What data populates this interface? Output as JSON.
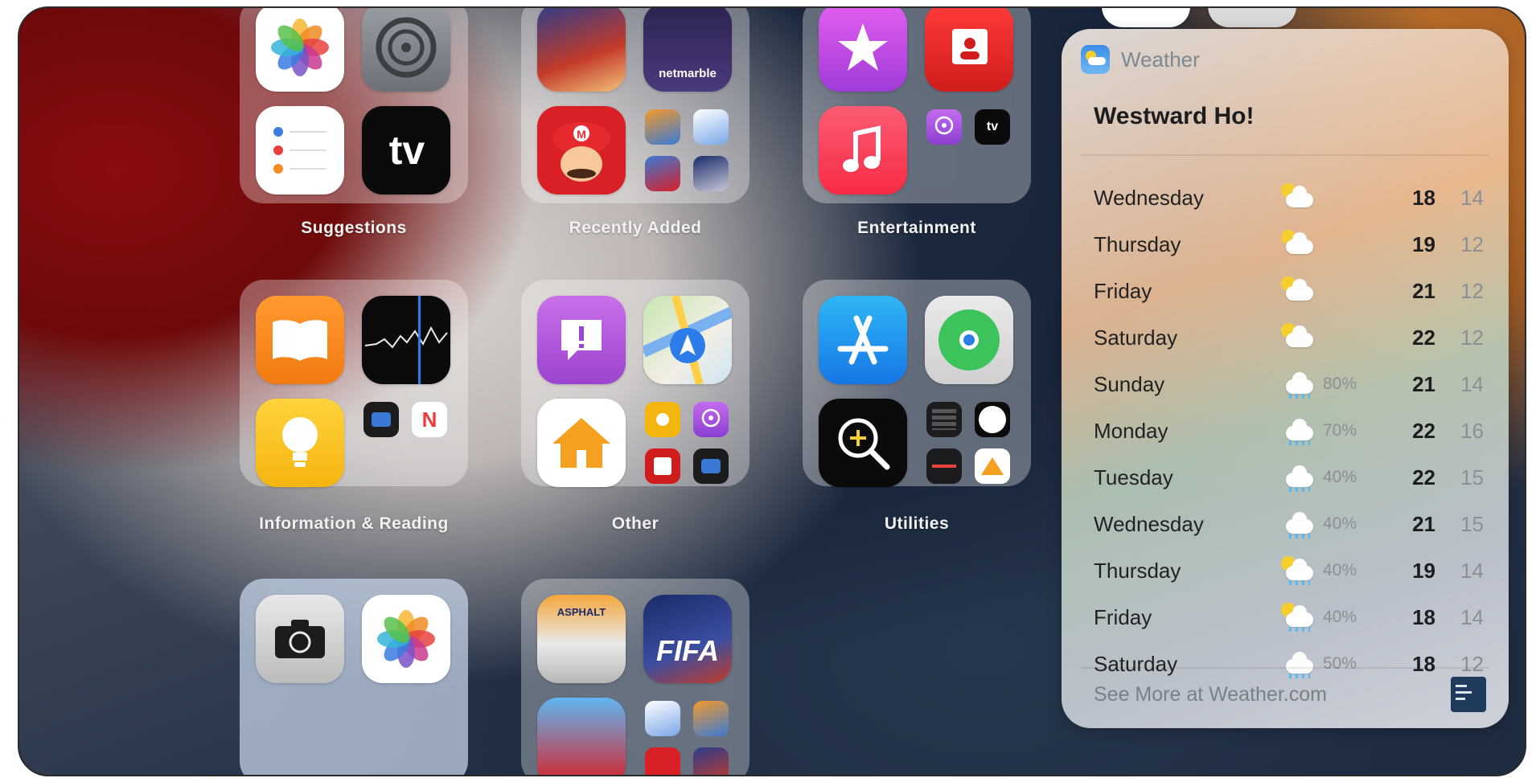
{
  "folders": [
    {
      "label": "Suggestions"
    },
    {
      "label": "Recently Added"
    },
    {
      "label": "Entertainment"
    },
    {
      "label": "Information & Reading"
    },
    {
      "label": "Other"
    },
    {
      "label": "Utilities"
    }
  ],
  "icons": {
    "tv_text": "tv",
    "asphalt_text": "ASPHALT",
    "fifa_text": "FIFA",
    "netmarble_text": "netmarble",
    "news_text": "N"
  },
  "weather": {
    "app_name": "Weather",
    "location": "Westward Ho!",
    "forecast": [
      {
        "day": "Wednesday",
        "icon": "partly-sunny-icon",
        "precip": "",
        "high": "18",
        "low": "14"
      },
      {
        "day": "Thursday",
        "icon": "partly-sunny-icon",
        "precip": "",
        "high": "19",
        "low": "12"
      },
      {
        "day": "Friday",
        "icon": "partly-sunny-icon",
        "precip": "",
        "high": "21",
        "low": "12"
      },
      {
        "day": "Saturday",
        "icon": "partly-sunny-icon",
        "precip": "",
        "high": "22",
        "low": "12"
      },
      {
        "day": "Sunday",
        "icon": "rain-icon",
        "precip": "80%",
        "high": "21",
        "low": "14"
      },
      {
        "day": "Monday",
        "icon": "rain-icon",
        "precip": "70%",
        "high": "22",
        "low": "16"
      },
      {
        "day": "Tuesday",
        "icon": "rain-icon",
        "precip": "40%",
        "high": "22",
        "low": "15"
      },
      {
        "day": "Wednesday",
        "icon": "rain-icon",
        "precip": "40%",
        "high": "21",
        "low": "15"
      },
      {
        "day": "Thursday",
        "icon": "sun-rain-icon",
        "precip": "40%",
        "high": "19",
        "low": "14"
      },
      {
        "day": "Friday",
        "icon": "sun-rain-icon",
        "precip": "40%",
        "high": "18",
        "low": "14"
      },
      {
        "day": "Saturday",
        "icon": "rain-icon",
        "precip": "50%",
        "high": "18",
        "low": "12"
      }
    ],
    "footer": "See More at Weather.com",
    "logo_text": "The Weather Channel"
  }
}
